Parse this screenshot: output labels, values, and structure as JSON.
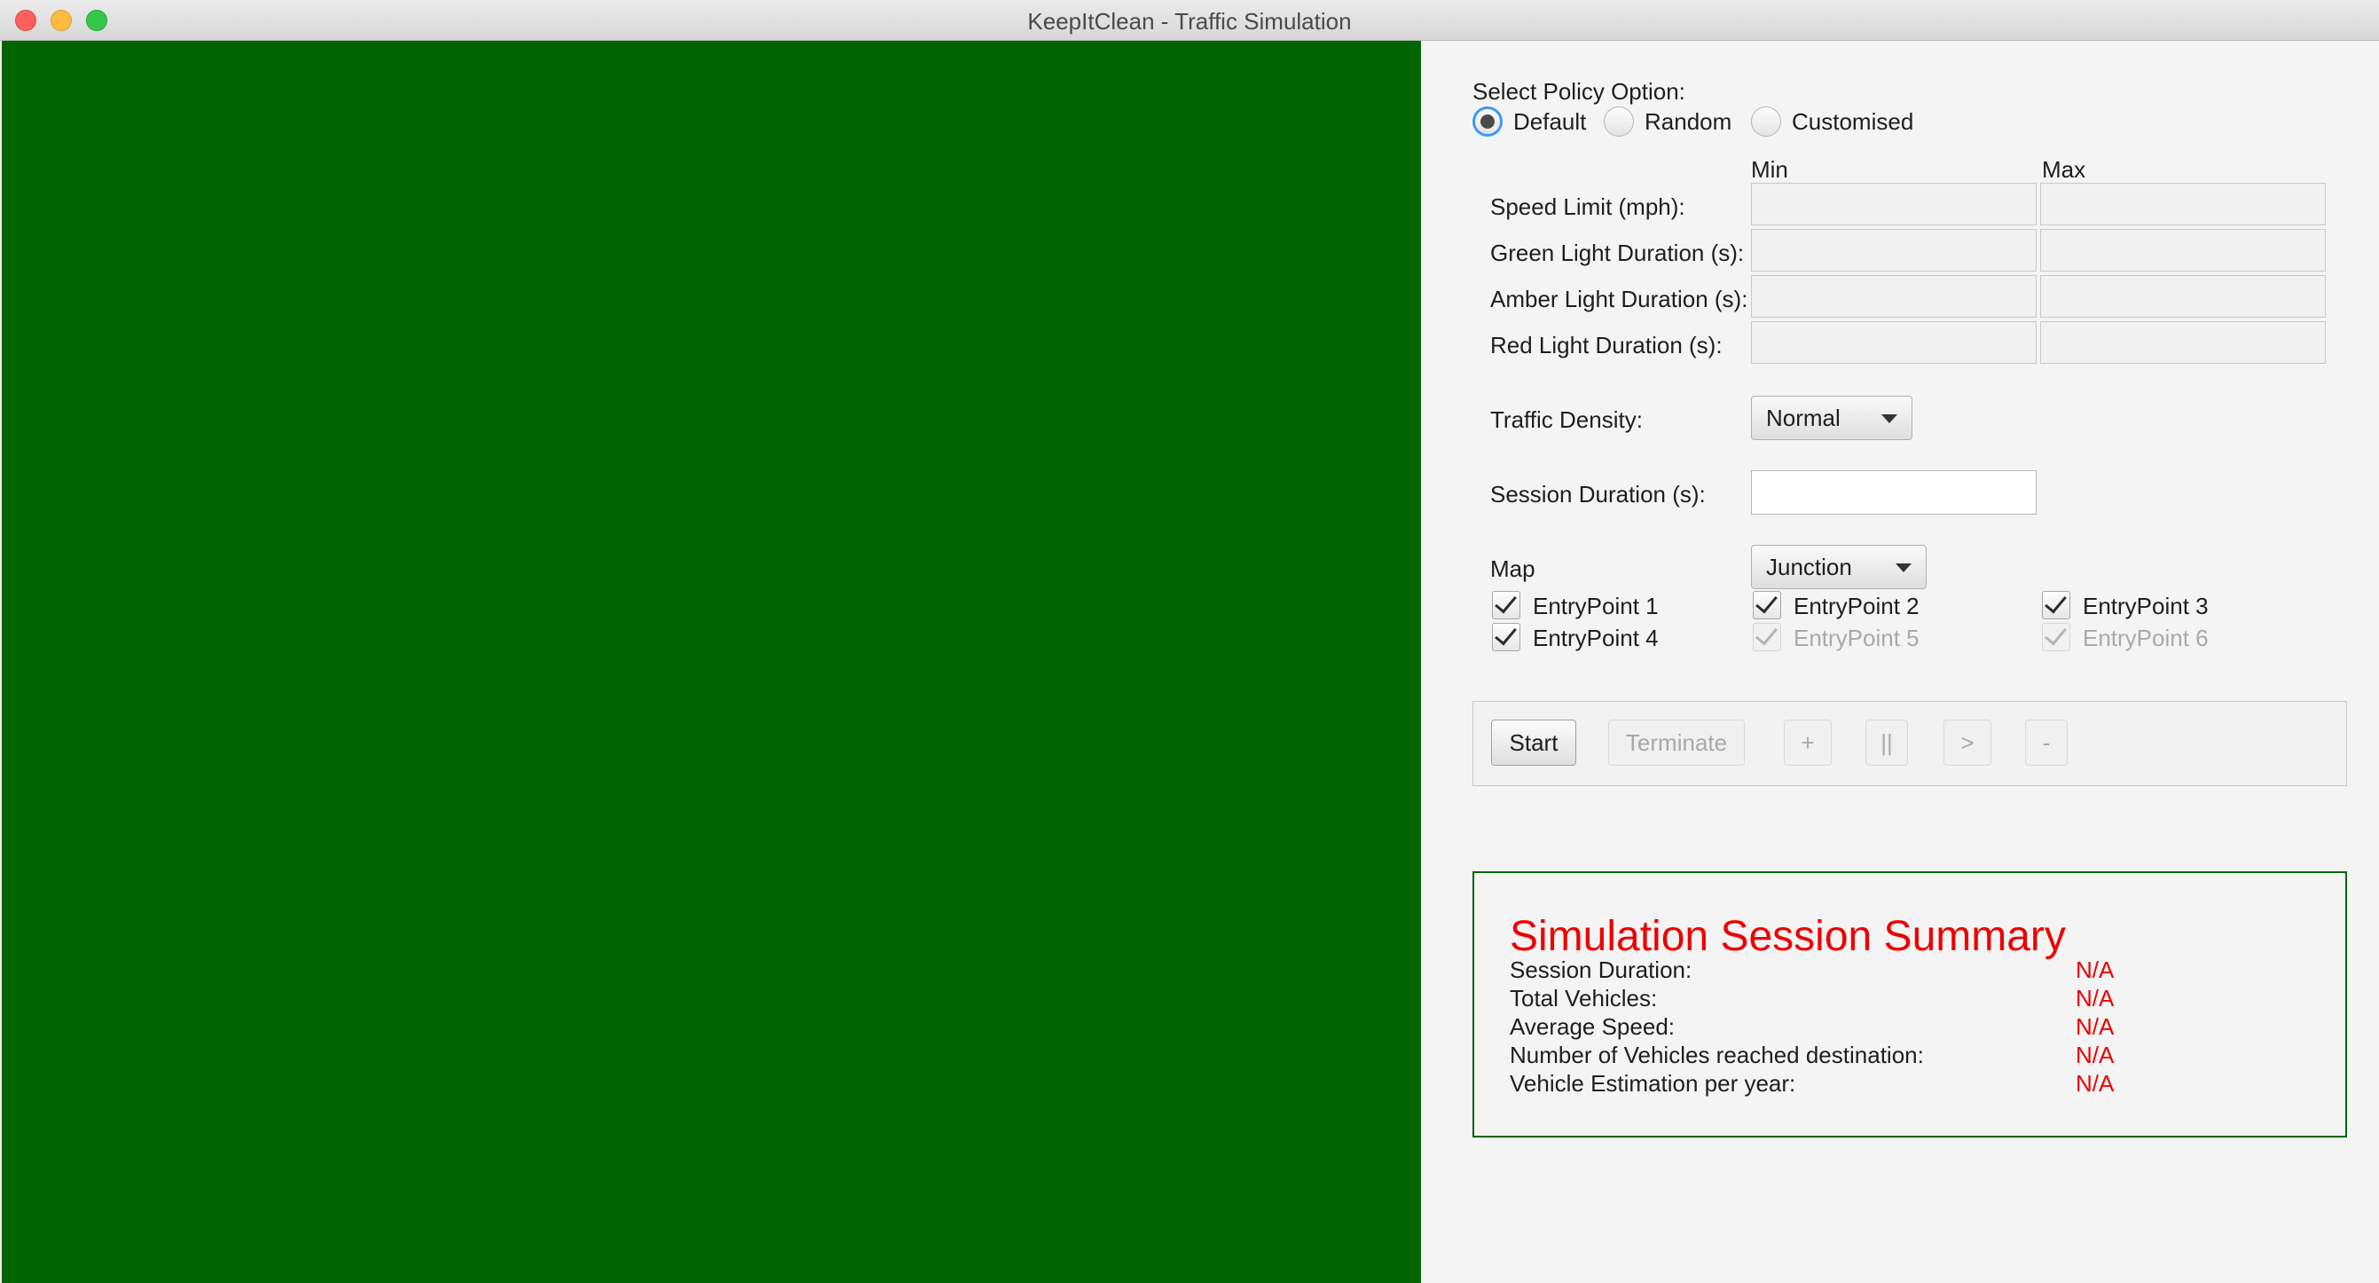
{
  "window": {
    "title": "KeepItClean - Traffic Simulation"
  },
  "colors": {
    "map_background": "#006400",
    "summary_accent": "#ee0000",
    "summary_border": "#006400",
    "radio_focus": "#3b99fc"
  },
  "policy": {
    "label": "Select Policy Option:",
    "options": [
      {
        "label": "Default",
        "selected": true
      },
      {
        "label": "Random",
        "selected": false
      },
      {
        "label": "Customised",
        "selected": false
      }
    ]
  },
  "ranges": {
    "min_header": "Min",
    "max_header": "Max",
    "rows": [
      {
        "label": "Speed Limit (mph):",
        "min": "",
        "max": ""
      },
      {
        "label": "Green Light Duration (s):",
        "min": "",
        "max": ""
      },
      {
        "label": "Amber Light Duration (s):",
        "min": "",
        "max": ""
      },
      {
        "label": "Red Light Duration (s):",
        "min": "",
        "max": ""
      }
    ]
  },
  "traffic_density": {
    "label": "Traffic Density:",
    "selected": "Normal"
  },
  "session_duration": {
    "label": "Session Duration (s):",
    "value": ""
  },
  "map": {
    "label": "Map",
    "selected": "Junction",
    "entry_points": [
      {
        "label": "EntryPoint 1",
        "checked": true,
        "enabled": true
      },
      {
        "label": "EntryPoint 2",
        "checked": true,
        "enabled": true
      },
      {
        "label": "EntryPoint 3",
        "checked": true,
        "enabled": true
      },
      {
        "label": "EntryPoint 4",
        "checked": true,
        "enabled": true
      },
      {
        "label": "EntryPoint 5",
        "checked": true,
        "enabled": false
      },
      {
        "label": "EntryPoint 6",
        "checked": true,
        "enabled": false
      }
    ]
  },
  "controls": {
    "start": "Start",
    "terminate": "Terminate",
    "speed_up": "+",
    "pause": "||",
    "resume": ">",
    "slow_down": "-"
  },
  "summary": {
    "title": "Simulation Session Summary",
    "rows": [
      {
        "label": "Session Duration:",
        "value": "N/A"
      },
      {
        "label": "Total Vehicles:",
        "value": "N/A"
      },
      {
        "label": "Average Speed:",
        "value": "N/A"
      },
      {
        "label": "Number of Vehicles reached destination:",
        "value": "N/A"
      },
      {
        "label": "Vehicle Estimation per year:",
        "value": "N/A"
      }
    ]
  }
}
